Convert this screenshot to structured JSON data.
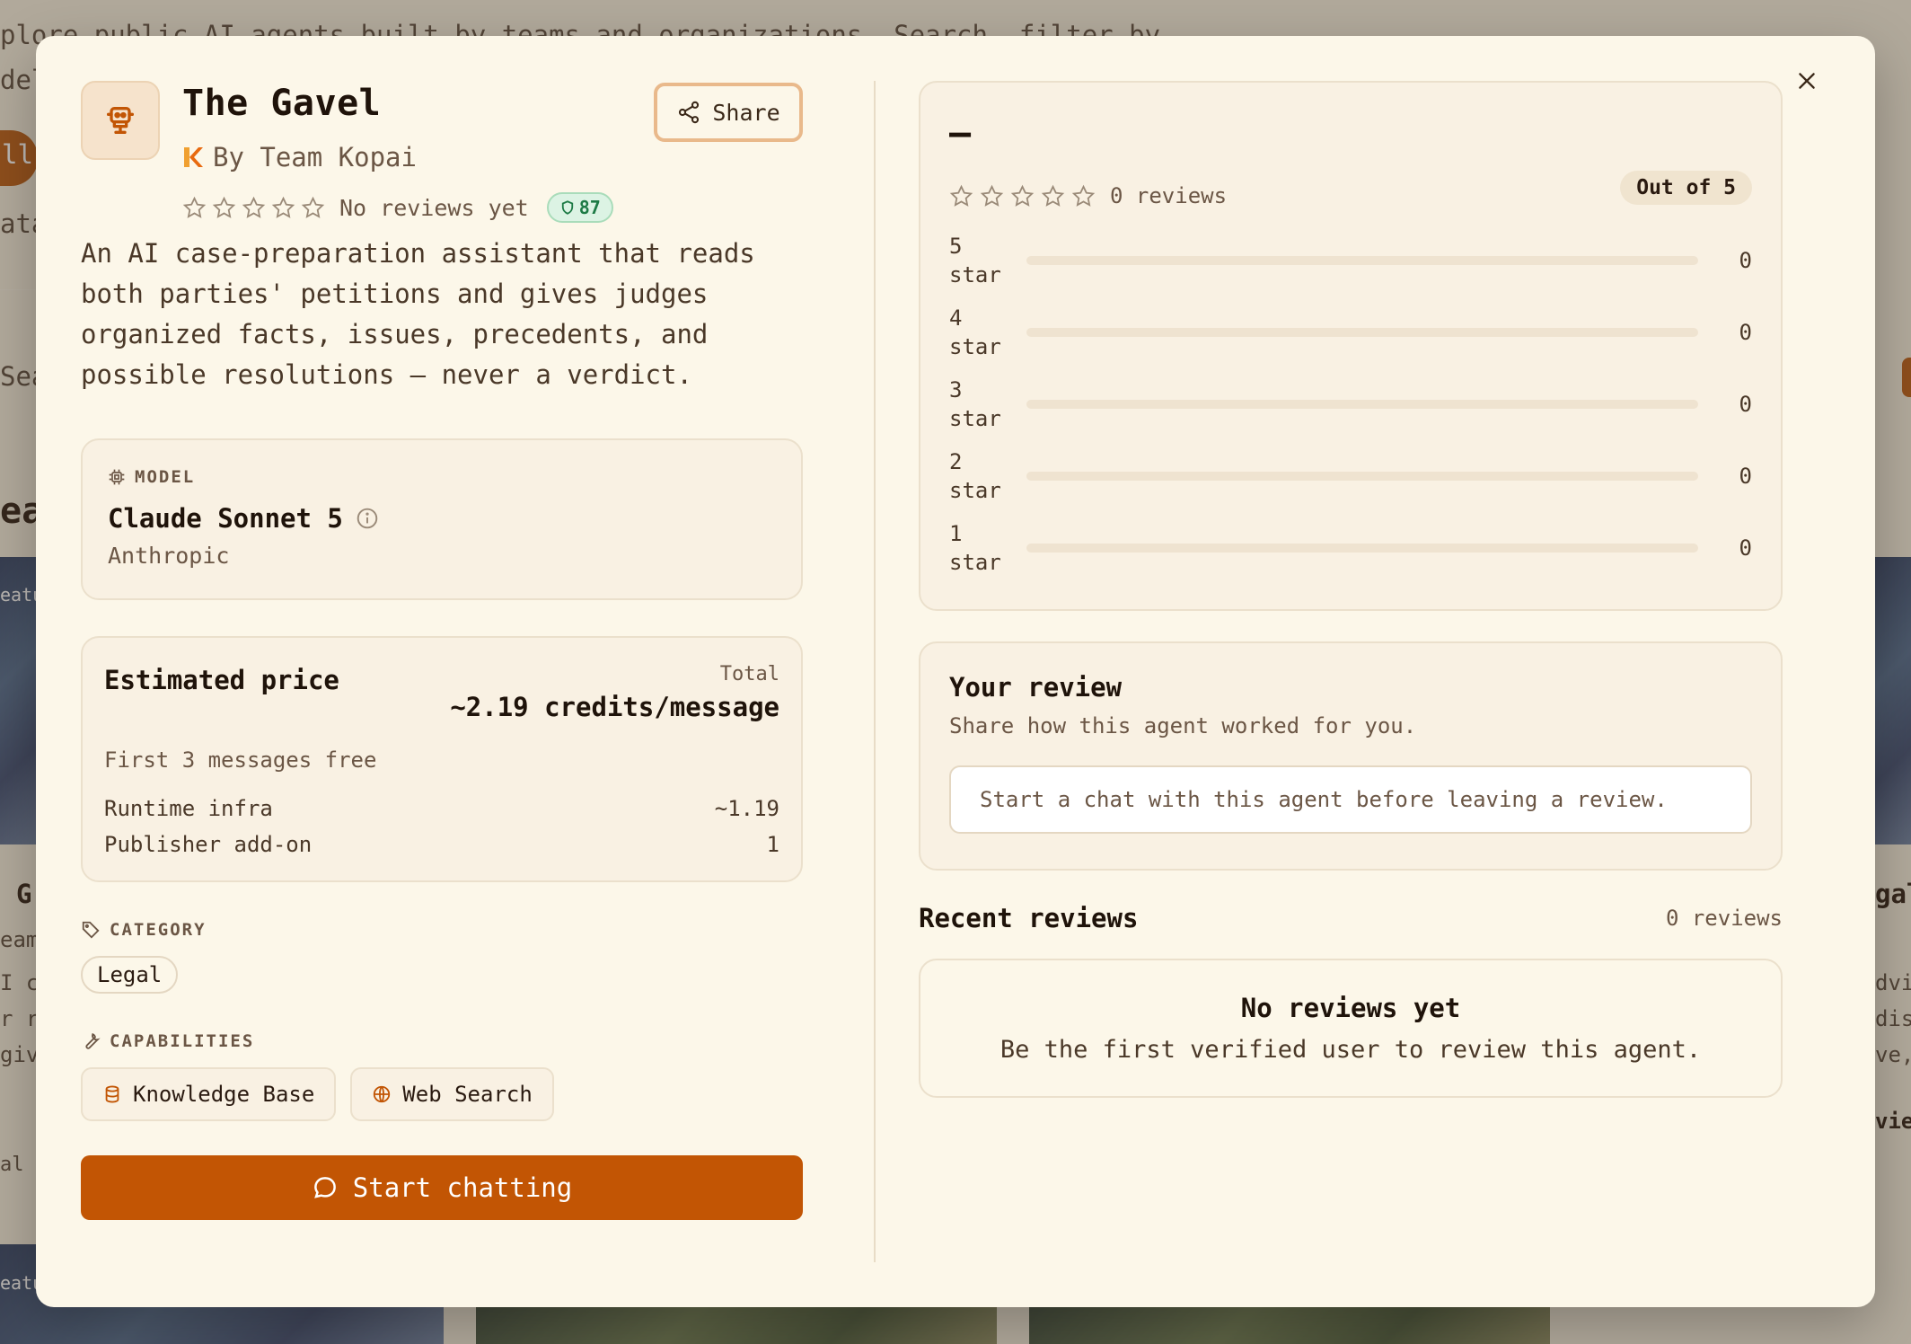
{
  "background": {
    "intro_line1": "plore public AI agents built by teams and organizations. Search, filter by",
    "intro_line2": "del",
    "pill_text": "ll",
    "left_labels": [
      "ata",
      "Sea",
      "eat",
      "eatu",
      "G",
      "eam",
      "I c",
      "r re",
      "giv",
      "al",
      "eatu"
    ],
    "right_labels": [
      "gal",
      "dvi",
      "dis",
      "ve,",
      "vie"
    ]
  },
  "agent": {
    "title": "The Gavel",
    "by": "By Team Kopai",
    "reviews_text": "No reviews yet",
    "score_badge": "87",
    "description": "An AI case-preparation assistant that reads both parties' petitions and gives judges organized facts, issues, precedents, and possible resolutions — never a verdict.",
    "share_label": "Share",
    "avatar_icon": "robot-icon",
    "star_rating": 0
  },
  "model": {
    "label": "MODEL",
    "name": "Claude Sonnet 5",
    "provider": "Anthropic"
  },
  "price": {
    "title": "Estimated price",
    "total_label": "Total",
    "total": "~2.19 credits/message",
    "free": "First 3 messages free",
    "rows": [
      {
        "label": "Runtime infra",
        "value": "~1.19"
      },
      {
        "label": "Publisher add-on",
        "value": "1"
      }
    ]
  },
  "category": {
    "label": "CATEGORY",
    "value": "Legal"
  },
  "capabilities": {
    "label": "CAPABILITIES",
    "items": [
      {
        "label": "Knowledge Base",
        "icon": "database-icon"
      },
      {
        "label": "Web Search",
        "icon": "globe-icon"
      }
    ]
  },
  "start_button": "Start chatting",
  "ratings": {
    "average": "—",
    "reviews_count": "0 reviews",
    "out_of": "Out of 5",
    "distribution": [
      {
        "label_num": "5",
        "label_unit": "star",
        "count": "0",
        "fraction": 0
      },
      {
        "label_num": "4",
        "label_unit": "star",
        "count": "0",
        "fraction": 0
      },
      {
        "label_num": "3",
        "label_unit": "star",
        "count": "0",
        "fraction": 0
      },
      {
        "label_num": "2",
        "label_unit": "star",
        "count": "0",
        "fraction": 0
      },
      {
        "label_num": "1",
        "label_unit": "star",
        "count": "0",
        "fraction": 0
      }
    ]
  },
  "your_review": {
    "title": "Your review",
    "subtitle": "Share how this agent worked for you.",
    "placeholder": "Start a chat with this agent before leaving a review."
  },
  "recent_reviews": {
    "title": "Recent reviews",
    "count": "0 reviews",
    "empty_title": "No reviews yet",
    "empty_subtitle": "Be the first verified user to review this agent."
  },
  "colors": {
    "accent": "#c25504",
    "background": "#fcf7e9",
    "badge_green": "#1d7a45"
  }
}
